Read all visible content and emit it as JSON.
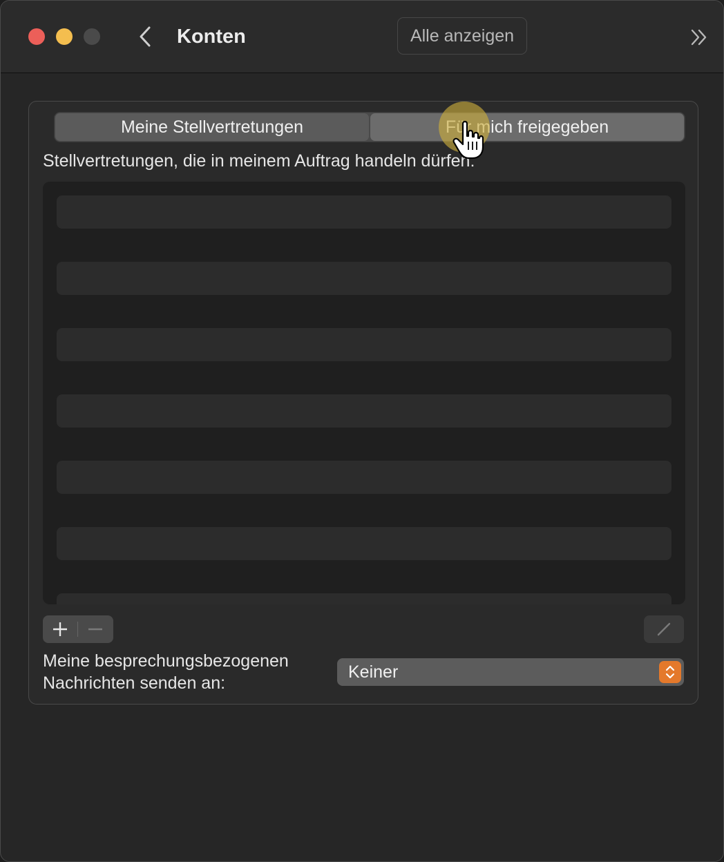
{
  "titlebar": {
    "title": "Konten",
    "show_all_label": "Alle anzeigen",
    "back_icon": "chevron-left-icon",
    "overflow_icon": "double-chevron-right-icon"
  },
  "tabs": [
    {
      "label": "Meine Stellvertretungen",
      "selected": false
    },
    {
      "label": "Für mich freigegeben",
      "selected": true
    }
  ],
  "delegates": {
    "description": "Stellvertretungen, die in meinem Auftrag handeln dürfen:",
    "rows": []
  },
  "controls": {
    "add_icon": "plus-icon",
    "remove_icon": "minus-icon",
    "edit_icon": "pencil-icon"
  },
  "meeting_messages": {
    "label_line1": "Meine besprechungsbezogenen",
    "label_line2": "Nachrichten senden an:",
    "selected_value": "Keiner"
  },
  "colors": {
    "close": "#ec5f59",
    "minimize": "#f4be4f",
    "accent": "#e4792b"
  }
}
